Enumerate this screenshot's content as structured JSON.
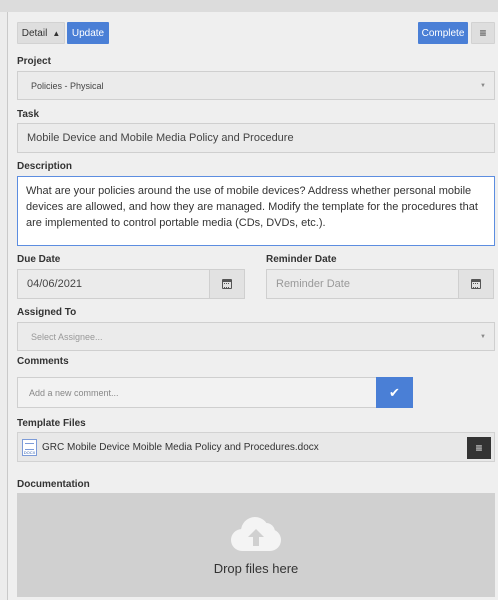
{
  "toolbar": {
    "detail_label": "Detail",
    "detail_caret": "▲",
    "update_label": "Update",
    "complete_label": "Complete",
    "menu_glyph": "≡"
  },
  "project": {
    "label": "Project",
    "value": "Policies - Physical",
    "arrow": "▼"
  },
  "task": {
    "label": "Task",
    "value": "Mobile Device and Mobile Media Policy and Procedure"
  },
  "description": {
    "label": "Description",
    "value": "What are your policies around the use of mobile devices?  Address whether personal mobile devices are allowed, and how they are managed.  Modify the template for the procedures that are implemented to control portable media (CDs, DVDs, etc.)."
  },
  "due_date": {
    "label": "Due Date",
    "value": "04/06/2021",
    "icon": "calendar-icon"
  },
  "reminder_date": {
    "label": "Reminder Date",
    "placeholder": "Reminder Date",
    "icon": "calendar-icon"
  },
  "assigned_to": {
    "label": "Assigned To",
    "placeholder": "Select Assignee...",
    "arrow": "▼"
  },
  "comments": {
    "label": "Comments",
    "placeholder": "Add a new comment...",
    "submit_glyph": "✔"
  },
  "template_files": {
    "label": "Template Files",
    "files": [
      {
        "name": "GRC Mobile Device Moible Media Policy and Procedures.docx",
        "icon": "docx-file-icon",
        "icon_text": "DOCX"
      }
    ],
    "menu_glyph": "≡"
  },
  "documentation": {
    "label": "Documentation",
    "drop_text": "Drop files here",
    "icon": "cloud-upload-icon"
  },
  "colors": {
    "accent": "#4a7fd6",
    "background": "#efefef",
    "dropzone": "#d0d0d0"
  }
}
